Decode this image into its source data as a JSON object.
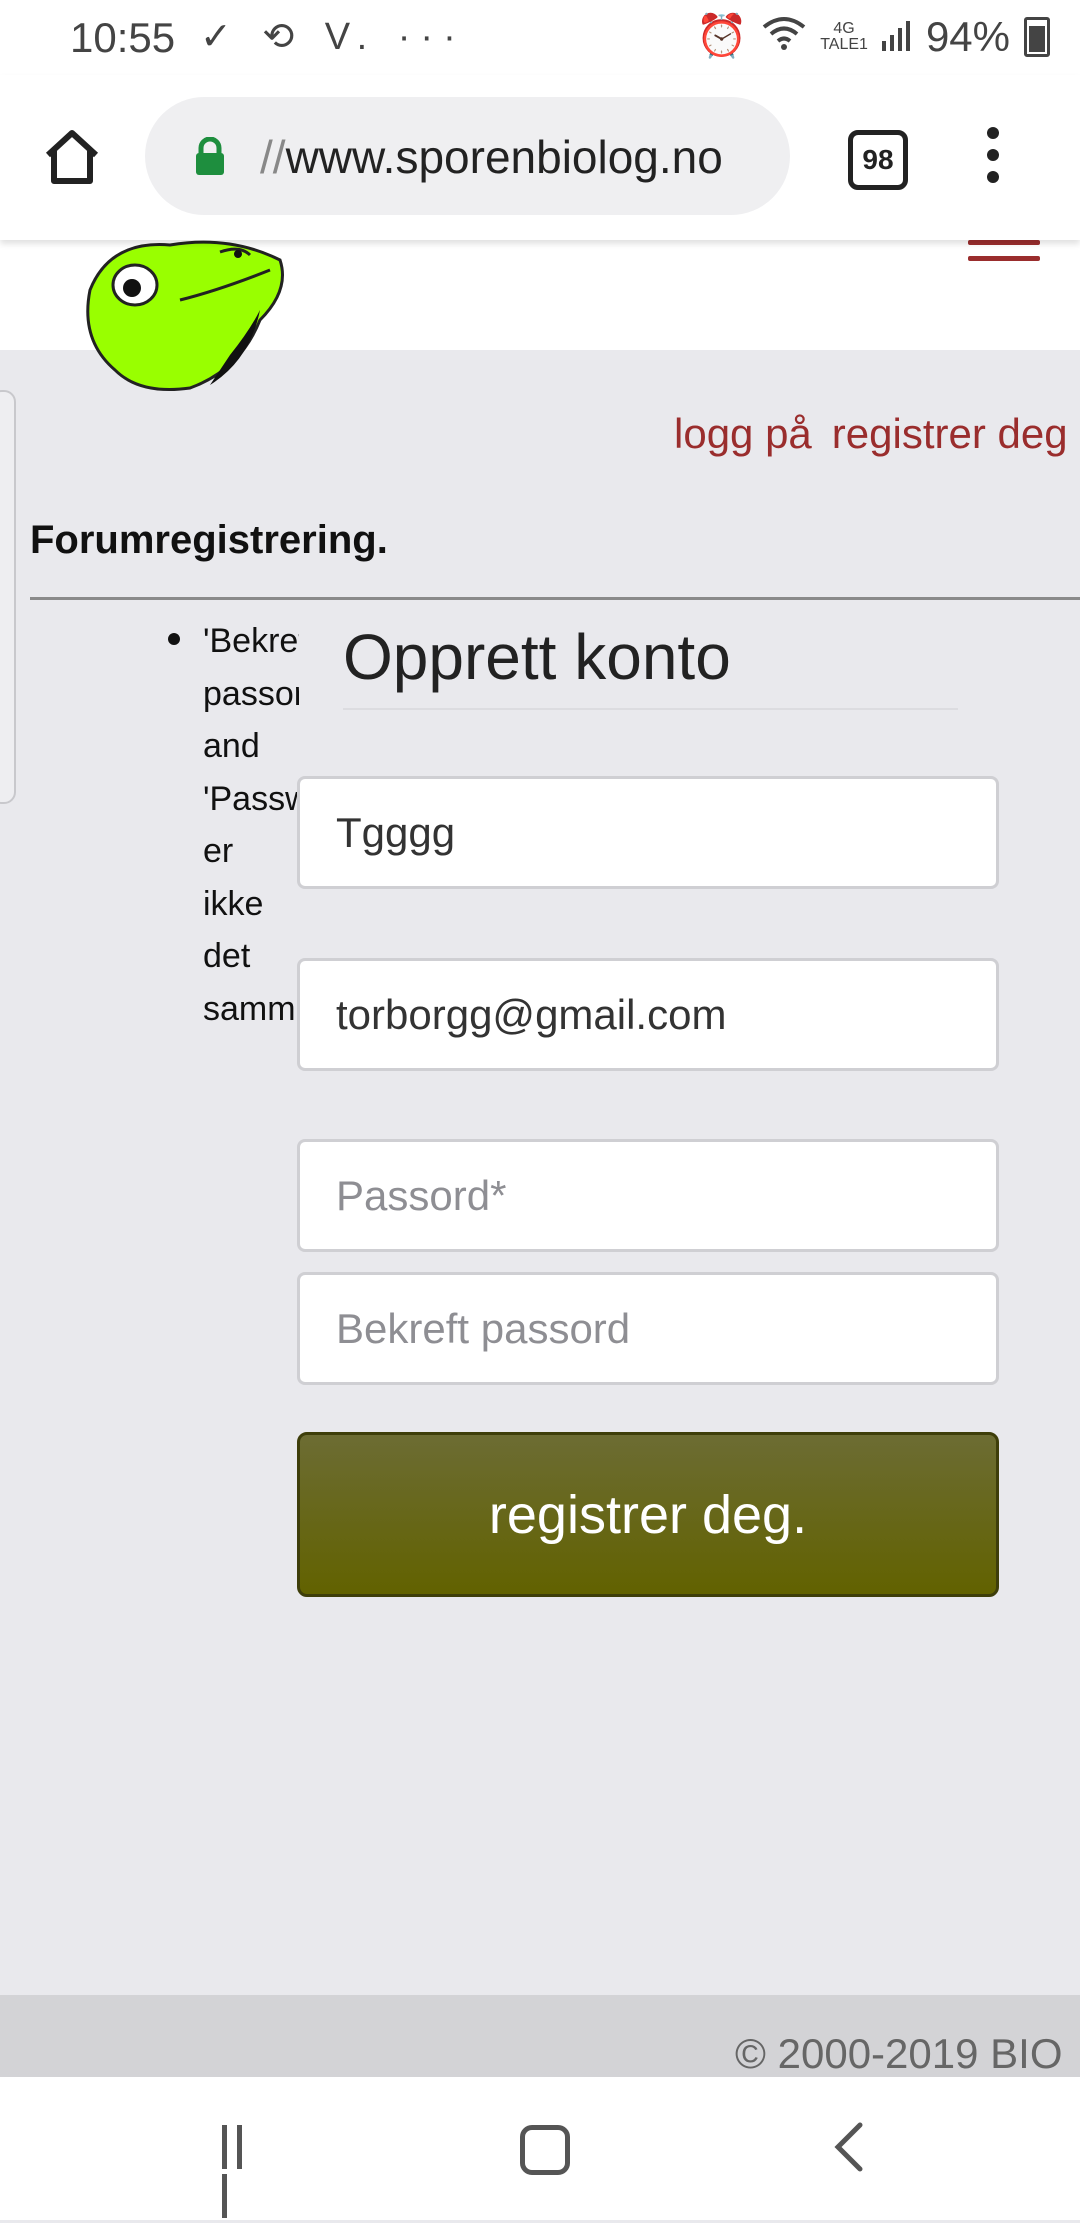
{
  "status_bar": {
    "time": "10:55",
    "left_icons": "✓ ⟲ V. ···",
    "network_top": "4G",
    "network_bottom": "TALE1",
    "battery": "94%"
  },
  "browser": {
    "url_prefix": "//",
    "url": "www.sporenbiolog.no",
    "tab_count": "98"
  },
  "nav": {
    "login": "logg på",
    "register": "registrer deg"
  },
  "page": {
    "forum_title": "Forumregistrering.",
    "error_message": "'Bekreft\npassord'\nand\n'Passw\ner\nikke\ndet\nsamm",
    "form_title": "Opprett konto"
  },
  "form": {
    "username_value": "Tgggg",
    "email_value": "torborgg@gmail.com",
    "password_placeholder": "Passord*",
    "confirm_placeholder": "Bekreft passord",
    "submit_label": "registrer deg."
  },
  "footer": {
    "copyright": "© 2000-2019 BIO"
  },
  "colors": {
    "accent_link": "#9a2d2d",
    "button": "#626200",
    "background": "#e9e9ed"
  }
}
